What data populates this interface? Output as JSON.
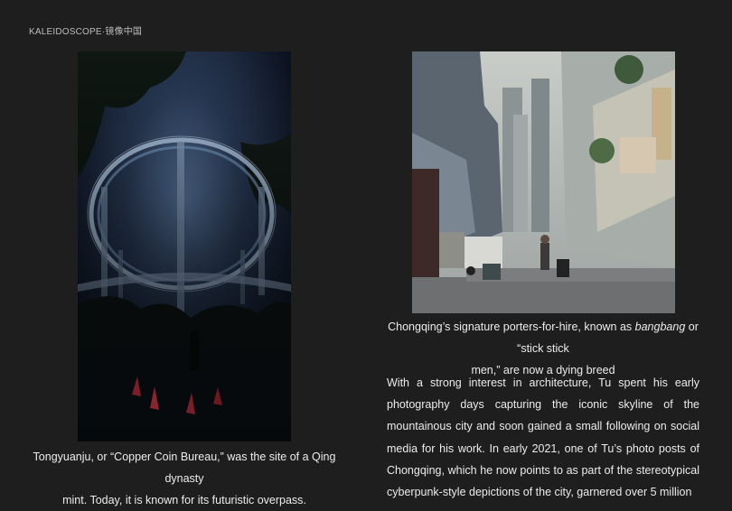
{
  "header": {
    "brand": "KALEIDOSCOPE·镜像中国"
  },
  "left_photo": {
    "caption_line1": "Tongyuanju, or “Copper Coin Bureau,” was the site of a Qing dynasty",
    "caption_line2": "mint. Today, it is known for its futuristic overpass."
  },
  "right_photo": {
    "caption_before_em": "Chongqing’s signature porters-for-hire, known as ",
    "caption_em": "bangbang",
    "caption_after_em": " or “stick stick",
    "caption_line2": "men,” are now a dying breed"
  },
  "article": {
    "paragraph": "With a strong interest in architecture, Tu spent his early photography days capturing the iconic skyline of the mountainous city and soon gained a small following on social media for his work. In early 2021, one of Tu’s photo posts of Chongqing, which he now points to as part of the stereotypical cyberpunk-style depictions of the city, garnered over 5 million"
  }
}
